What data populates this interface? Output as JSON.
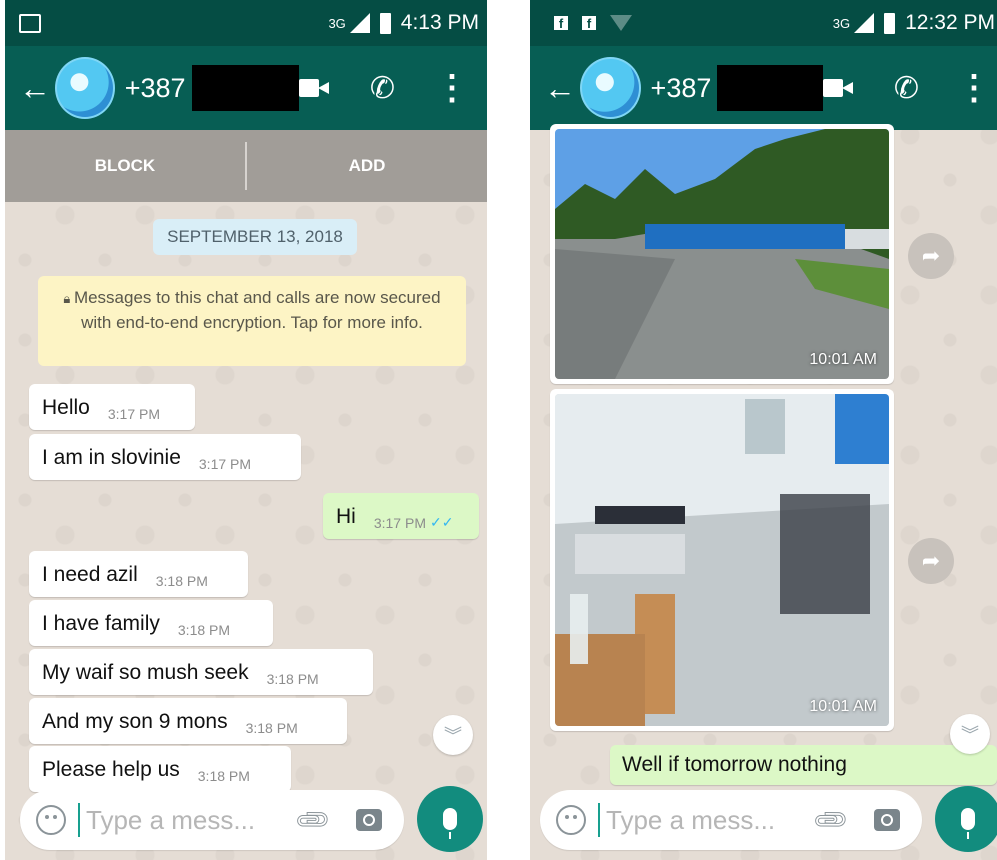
{
  "left": {
    "status": {
      "network": "3G",
      "time": "4:13 PM"
    },
    "header": {
      "number": "+387"
    },
    "actions": {
      "block": "BLOCK",
      "add": "ADD"
    },
    "date_chip": "SEPTEMBER 13, 2018",
    "encryption_notice": "Messages to this chat and calls are now secured with end-to-end encryption. Tap for more info.",
    "messages": [
      {
        "text": "Hello",
        "time": "3:17 PM"
      },
      {
        "text": "I am in slovinie",
        "time": "3:17 PM"
      },
      {
        "text": "Hi",
        "time": "3:17 PM"
      },
      {
        "text": "I need azil",
        "time": "3:18 PM"
      },
      {
        "text": "I have family",
        "time": "3:18 PM"
      },
      {
        "text": "My waif so mush seek",
        "time": "3:18 PM"
      },
      {
        "text": "And my son 9 mons",
        "time": "3:18 PM"
      },
      {
        "text": "Please help us",
        "time": "3:18 PM"
      }
    ],
    "composer": {
      "placeholder": "Type a mess..."
    }
  },
  "right": {
    "status": {
      "network": "3G",
      "time": "12:32 PM"
    },
    "header": {
      "number": "+387"
    },
    "photos": [
      {
        "time": "10:01 AM"
      },
      {
        "time": "10:01 AM"
      }
    ],
    "outgoing_partial": "Well if tomorrow nothing",
    "composer": {
      "placeholder": "Type a mess..."
    }
  },
  "colors": {
    "header": "#075e54",
    "statusbar": "#054d44",
    "outgoing": "#dcf8c6",
    "accent": "#128c7e"
  },
  "icons": [
    "back-arrow-icon",
    "video-call-icon",
    "phone-call-icon",
    "more-options-icon",
    "lock-icon",
    "double-check-icon",
    "scroll-down-icon",
    "emoji-icon",
    "attach-icon",
    "camera-icon",
    "mic-icon",
    "forward-icon",
    "facebook-icon",
    "wifi-icon",
    "image-notification-icon"
  ]
}
